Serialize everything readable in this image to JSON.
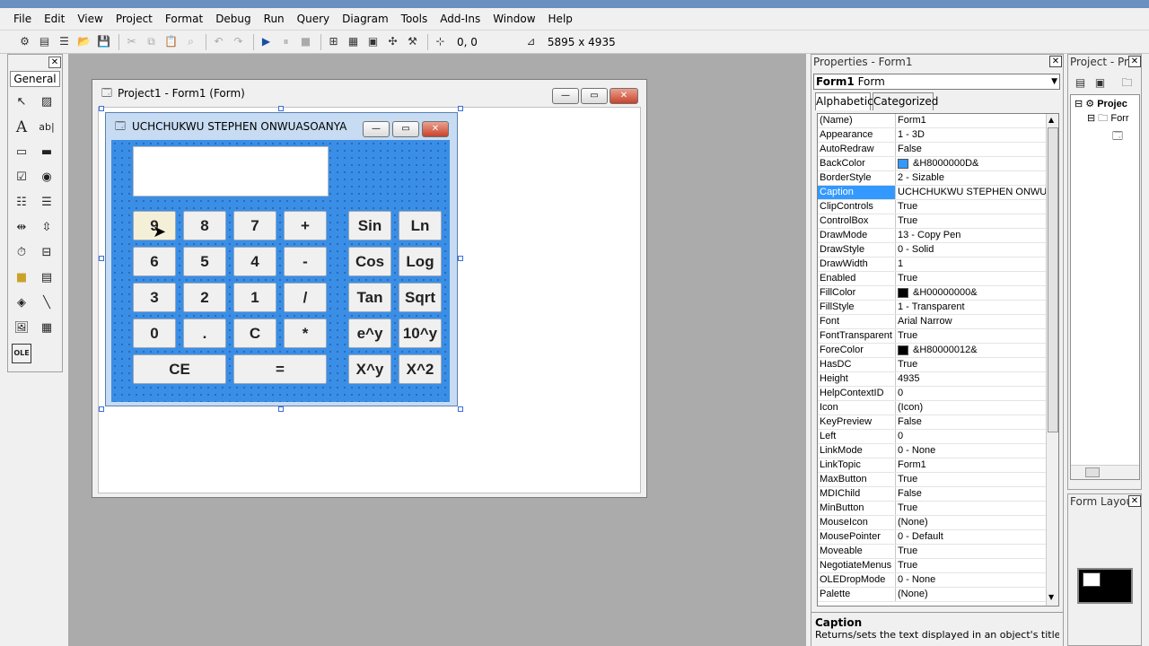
{
  "menu": [
    "File",
    "Edit",
    "View",
    "Project",
    "Format",
    "Debug",
    "Run",
    "Query",
    "Diagram",
    "Tools",
    "Add-Ins",
    "Window",
    "Help"
  ],
  "toolbar": {
    "position": "0, 0",
    "size": "5895 x 4935"
  },
  "toolbox": {
    "tab": "General"
  },
  "form_window": {
    "title": "Project1 - Form1 (Form)"
  },
  "calculator": {
    "title": "UCHCHUKWU STEPHEN ONWUASOANYA",
    "buttons_left": [
      [
        "9",
        "8",
        "7",
        "+"
      ],
      [
        "6",
        "5",
        "4",
        "-"
      ],
      [
        "3",
        "2",
        "1",
        "/"
      ],
      [
        "0",
        ".",
        "C",
        "*"
      ]
    ],
    "bottom": [
      "CE",
      "="
    ],
    "buttons_right": [
      [
        "Sin",
        "Ln"
      ],
      [
        "Cos",
        "Log"
      ],
      [
        "Tan",
        "Sqrt"
      ],
      [
        "e^y",
        "10^y"
      ],
      [
        "X^y",
        "X^2"
      ]
    ]
  },
  "properties": {
    "title": "Properties - Form1",
    "object_name": "Form1",
    "object_type": "Form",
    "tab_alphabetic": "Alphabetic",
    "tab_categorized": "Categorized",
    "rows": [
      {
        "name": "(Name)",
        "value": "Form1"
      },
      {
        "name": "Appearance",
        "value": "1 - 3D"
      },
      {
        "name": "AutoRedraw",
        "value": "False"
      },
      {
        "name": "BackColor",
        "value": "&H8000000D&",
        "swatch": "#3399ff"
      },
      {
        "name": "BorderStyle",
        "value": "2 - Sizable"
      },
      {
        "name": "Caption",
        "value": "UCHCHUKWU STEPHEN ONWUASO",
        "selected": true
      },
      {
        "name": "ClipControls",
        "value": "True"
      },
      {
        "name": "ControlBox",
        "value": "True"
      },
      {
        "name": "DrawMode",
        "value": "13 - Copy Pen"
      },
      {
        "name": "DrawStyle",
        "value": "0 - Solid"
      },
      {
        "name": "DrawWidth",
        "value": "1"
      },
      {
        "name": "Enabled",
        "value": "True"
      },
      {
        "name": "FillColor",
        "value": "&H00000000&",
        "swatch": "#000000"
      },
      {
        "name": "FillStyle",
        "value": "1 - Transparent"
      },
      {
        "name": "Font",
        "value": "Arial Narrow"
      },
      {
        "name": "FontTransparent",
        "value": "True"
      },
      {
        "name": "ForeColor",
        "value": "&H80000012&",
        "swatch": "#000000"
      },
      {
        "name": "HasDC",
        "value": "True"
      },
      {
        "name": "Height",
        "value": "4935"
      },
      {
        "name": "HelpContextID",
        "value": "0"
      },
      {
        "name": "Icon",
        "value": "(Icon)"
      },
      {
        "name": "KeyPreview",
        "value": "False"
      },
      {
        "name": "Left",
        "value": "0"
      },
      {
        "name": "LinkMode",
        "value": "0 - None"
      },
      {
        "name": "LinkTopic",
        "value": "Form1"
      },
      {
        "name": "MaxButton",
        "value": "True"
      },
      {
        "name": "MDIChild",
        "value": "False"
      },
      {
        "name": "MinButton",
        "value": "True"
      },
      {
        "name": "MouseIcon",
        "value": "(None)"
      },
      {
        "name": "MousePointer",
        "value": "0 - Default"
      },
      {
        "name": "Moveable",
        "value": "True"
      },
      {
        "name": "NegotiateMenus",
        "value": "True"
      },
      {
        "name": "OLEDropMode",
        "value": "0 - None"
      },
      {
        "name": "Palette",
        "value": "(None)"
      }
    ],
    "desc_title": "Caption",
    "desc_text": "Returns/sets the text displayed in an object's title bar or"
  },
  "project_panel": {
    "title": "Project - Proj",
    "tree_root": "Projec",
    "tree_child": "Forr"
  },
  "layout_panel": {
    "title": "Form Layou"
  }
}
